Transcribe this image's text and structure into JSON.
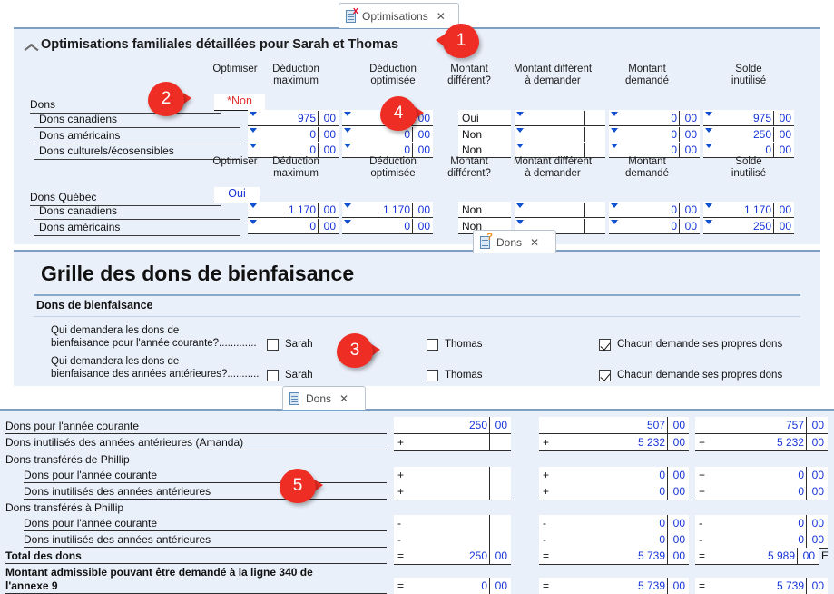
{
  "tabs": [
    {
      "label": "Optimisations",
      "icon": "document-icon",
      "badge": "x",
      "close": "✕"
    },
    {
      "label": "Dons",
      "icon": "document-icon",
      "badge": "?",
      "close": "✕"
    },
    {
      "label": "Dons",
      "icon": "document-icon",
      "badge": "",
      "close": "✕"
    }
  ],
  "optimisations": {
    "title": "Optimisations familiales détaillées pour Sarah et Thomas",
    "columns": [
      {
        "l1": "Optimiser",
        "l2": ""
      },
      {
        "l1": "Déduction",
        "l2": "maximum"
      },
      {
        "l1": "Déduction",
        "l2": "optimisée"
      },
      {
        "l1": "Montant",
        "l2": "différent?"
      },
      {
        "l1": "Montant différent",
        "l2": "à demander"
      },
      {
        "l1": "Montant",
        "l2": "demandé"
      },
      {
        "l1": "Solde",
        "l2": "inutilisé"
      }
    ],
    "section1": {
      "label": "Dons",
      "optimiser": "Non",
      "optimiser_asterisk": "*",
      "rows": [
        {
          "label": "Dons canadiens",
          "deduction_max": "975",
          "deduction_max_c": "00",
          "deduction_opt": "0",
          "deduction_opt_c": "00",
          "montant_different": "Oui",
          "montant_a_demander": "",
          "montant_a_demander_c": "",
          "montant_demande": "0",
          "montant_demande_c": "00",
          "solde": "975",
          "solde_c": "00"
        },
        {
          "label": "Dons américains",
          "deduction_max": "0",
          "deduction_max_c": "00",
          "deduction_opt": "0",
          "deduction_opt_c": "00",
          "montant_different": "Non",
          "montant_a_demander": "",
          "montant_a_demander_c": "",
          "montant_demande": "0",
          "montant_demande_c": "00",
          "solde": "250",
          "solde_c": "00"
        },
        {
          "label": "Dons culturels/écosensibles",
          "deduction_max": "0",
          "deduction_max_c": "00",
          "deduction_opt": "0",
          "deduction_opt_c": "00",
          "montant_different": "Non",
          "montant_a_demander": "",
          "montant_a_demander_c": "",
          "montant_demande": "0",
          "montant_demande_c": "00",
          "solde": "0",
          "solde_c": "00"
        }
      ]
    },
    "section2": {
      "label": "Dons Québec",
      "optimiser": "Oui",
      "rows": [
        {
          "label": "Dons canadiens",
          "deduction_max": "1 170",
          "deduction_max_c": "00",
          "deduction_opt": "1 170",
          "deduction_opt_c": "00",
          "montant_different": "Non",
          "montant_a_demander": "",
          "montant_a_demander_c": "",
          "montant_demande": "0",
          "montant_demande_c": "00",
          "solde": "1 170",
          "solde_c": "00"
        },
        {
          "label": "Dons américains",
          "deduction_max": "0",
          "deduction_max_c": "00",
          "deduction_opt": "0",
          "deduction_opt_c": "00",
          "montant_different": "Non",
          "montant_a_demander": "",
          "montant_a_demander_c": "",
          "montant_demande": "0",
          "montant_demande_c": "00",
          "solde": "250",
          "solde_c": "00"
        }
      ]
    }
  },
  "grille": {
    "heading": "Grille des dons de bienfaisance",
    "subheading": "Dons de bienfaisance",
    "questions": [
      {
        "line1": "Qui demandera les dons de",
        "line2": "bienfaisance pour l'année courante?.............",
        "opt_sarah": "Sarah",
        "sarah_checked": false,
        "opt_thomas": "Thomas",
        "thomas_checked": false,
        "opt_each": "Chacun demande ses propres dons",
        "each_checked": true
      },
      {
        "line1": "Qui demandera les dons de",
        "line2": "bienfaisance des années antérieures?...........",
        "opt_sarah": "Sarah",
        "sarah_checked": false,
        "opt_thomas": "Thomas",
        "thomas_checked": false,
        "opt_each": "Chacun demande ses propres dons",
        "each_checked": true
      }
    ]
  },
  "dons_table": {
    "rows": [
      {
        "label": "Dons pour l'année courante",
        "indent": 0,
        "underline": true,
        "c1_op": "",
        "c1": "250",
        "c1c": "00",
        "c2_op": "",
        "c2": "507",
        "c2c": "00",
        "c3_op": "",
        "c3": "757",
        "c3c": "00",
        "tag": ""
      },
      {
        "label": "Dons inutilisés des années antérieures (Amanda)",
        "indent": 0,
        "underline": true,
        "c1_op": "+",
        "c1": "",
        "c1c": "",
        "c2_op": "+",
        "c2": "5 232",
        "c2c": "00",
        "c3_op": "+",
        "c3": "5 232",
        "c3c": "00",
        "tag": ""
      },
      {
        "label": "Dons transférés de Phillip",
        "indent": 0,
        "underline": false,
        "header": true,
        "c1_op": "",
        "c1": "",
        "c1c": "",
        "c2_op": "",
        "c2": "",
        "c2c": "",
        "c3_op": "",
        "c3": "",
        "c3c": "",
        "tag": ""
      },
      {
        "label": "Dons pour l'année courante",
        "indent": 1,
        "underline": true,
        "c1_op": "+",
        "c1": "",
        "c1c": "",
        "c2_op": "+",
        "c2": "0",
        "c2c": "00",
        "c3_op": "+",
        "c3": "0",
        "c3c": "00",
        "tag": ""
      },
      {
        "label": "Dons inutilisés des années antérieures",
        "indent": 1,
        "underline": true,
        "c1_op": "+",
        "c1": "",
        "c1c": "",
        "c2_op": "+",
        "c2": "0",
        "c2c": "00",
        "c3_op": "+",
        "c3": "0",
        "c3c": "00",
        "tag": ""
      },
      {
        "label": "Dons transférés à Phillip",
        "indent": 0,
        "underline": false,
        "header": true,
        "c1_op": "",
        "c1": "",
        "c1c": "",
        "c2_op": "",
        "c2": "",
        "c2c": "",
        "c3_op": "",
        "c3": "",
        "c3c": "",
        "tag": ""
      },
      {
        "label": "Dons pour l'année courante",
        "indent": 1,
        "underline": true,
        "c1_op": "-",
        "c1": "",
        "c1c": "",
        "c2_op": "-",
        "c2": "0",
        "c2c": "00",
        "c3_op": "-",
        "c3": "0",
        "c3c": "00",
        "tag": ""
      },
      {
        "label": "Dons inutilisés des années antérieures",
        "indent": 1,
        "underline": true,
        "c1_op": "-",
        "c1": "",
        "c1c": "",
        "c2_op": "-",
        "c2": "0",
        "c2c": "00",
        "c3_op": "-",
        "c3": "0",
        "c3c": "00",
        "tag": ""
      },
      {
        "label": "Total des dons",
        "indent": 0,
        "underline": true,
        "bold": true,
        "c1_op": "=",
        "c1": "250",
        "c1c": "00",
        "c2_op": "=",
        "c2": "5 739",
        "c2c": "00",
        "c3_op": "=",
        "c3": "5 989",
        "c3c": "00",
        "tag": "E"
      }
    ],
    "final_row": {
      "line1": "Montant admissible pouvant être demandé à la ligne 340 de",
      "line2": "l'annexe 9",
      "c1_op": "=",
      "c1": "0",
      "c1c": "00",
      "c2_op": "=",
      "c2": "5 739",
      "c2c": "00",
      "c3_op": "=",
      "c3": "5 739",
      "c3c": "00"
    }
  },
  "callouts": [
    {
      "number": "1"
    },
    {
      "number": "2"
    },
    {
      "number": "3"
    },
    {
      "number": "4"
    },
    {
      "number": "5"
    }
  ],
  "colors": {
    "accent": "#ee2d24",
    "panel": "#eaf0fa",
    "value": "#1734d8",
    "alert": "#e03030"
  }
}
